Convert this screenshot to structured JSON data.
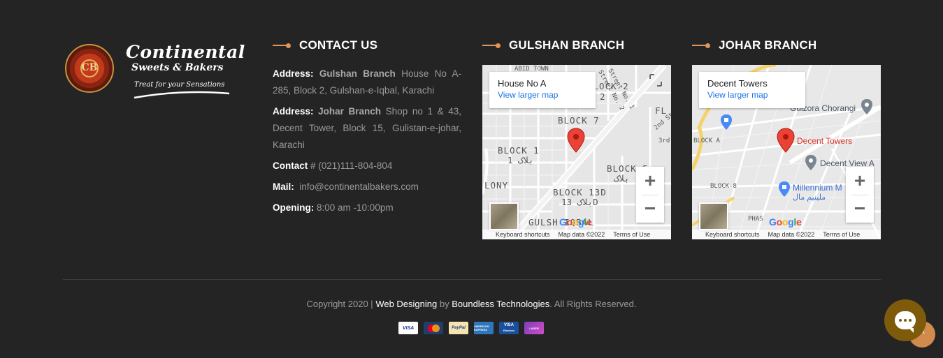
{
  "brand": {
    "name": "Continental",
    "subtitle": "Sweets & Bakers",
    "tagline": "Treat for your Sensations",
    "badge_text": "CB"
  },
  "contact": {
    "heading": "CONTACT US",
    "address_label": "Address:",
    "address1_branch": "Gulshan Branch",
    "address1_text": "House No A-285, Block 2, Gulshan-e-Iqbal, Karachi",
    "address2_branch": "Johar Branch",
    "address2_text": "Shop no 1 & 43, Decent Tower, Block 15, Gulistan-e-johar, Karachi",
    "contact_label": "Contact",
    "contact_value": "# (021)111-804-804",
    "mail_label": "Mail:",
    "mail_value": "info@continentalbakers.com",
    "opening_label": "Opening:",
    "opening_value": "8:00 am -10:00pm"
  },
  "gulshan": {
    "heading": "GULSHAN BRANCH",
    "place": "House No A",
    "link": "View larger map",
    "labels": {
      "abid": "ABID TOWN",
      "block2": "BLOCK 2",
      "block2num": "2",
      "block7": "BLOCK 7",
      "block1": "BLOCK 1",
      "block1ur": "بلاک 1",
      "block5": "BLOCK 5",
      "block5ur": "بلاک",
      "block13d": "BLOCK 13D",
      "block13dur": "بلاک 13D",
      "colony": "LONY",
      "gulshan": "GULSH    IQBAL",
      "fl": "FL",
      "street1": "Street No. 1",
      "street2": "Street No. 2",
      "second": "2nd St",
      "third": "3rd"
    },
    "footer": [
      "Keyboard shortcuts",
      "Map data ©2022",
      "Terms of Use"
    ]
  },
  "johar": {
    "heading": "JOHAR BRANCH",
    "place": "Decent Towers",
    "link": "View larger map",
    "labels": {
      "chorangi": "Gulzora Chorangi",
      "pin": "Decent Towers",
      "view": "Decent View A",
      "millennium": "Millennium M",
      "millennium_ur": "ملینیم مال",
      "blocka": "BLOCK A",
      "block8": "BLOCK-8",
      "phase": "PHAS"
    },
    "footer": [
      "Keyboard shortcuts",
      "Map data ©2022",
      "Terms of Use"
    ]
  },
  "map_controls": {
    "zoom_in": "+",
    "zoom_out": "−",
    "google": [
      "G",
      "o",
      "o",
      "g",
      "l",
      "e"
    ]
  },
  "footer": {
    "copyright_prefix": "Copyright 2020 |",
    "web_designing": "Web Designing",
    "by": "by",
    "company": "Boundless Technologies",
    "suffix": ". All Rights Reserved."
  },
  "payments": {
    "visa": "VISA",
    "paypal": "PayPal",
    "amex": "AMERICAN EXPRESS",
    "ve_top": "VISA",
    "ve_bottom": "Electron",
    "laser": "LASER"
  },
  "scroll_top_icon": "^",
  "colors": {
    "background": "#242424",
    "accent": "#e0955a",
    "chat": "#7d5b0b"
  }
}
